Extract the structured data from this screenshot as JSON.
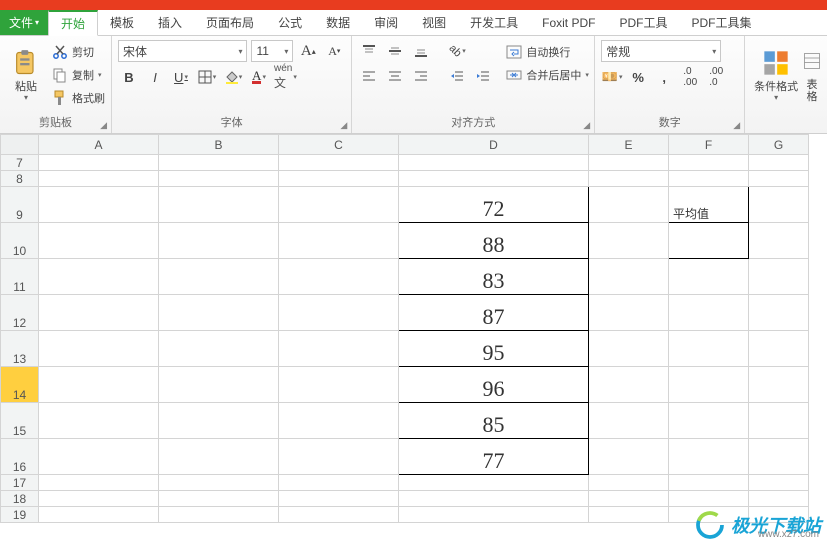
{
  "menu": {
    "file": "文件",
    "tabs": [
      "开始",
      "模板",
      "插入",
      "页面布局",
      "公式",
      "数据",
      "审阅",
      "视图",
      "开发工具",
      "Foxit PDF",
      "PDF工具",
      "PDF工具集"
    ],
    "active_index": 0
  },
  "ribbon": {
    "clipboard": {
      "label": "剪贴板",
      "paste": "粘贴",
      "cut": "剪切",
      "copy": "复制",
      "format_painter": "格式刷"
    },
    "font": {
      "label": "字体",
      "name": "宋体",
      "size": "11",
      "grow": "A",
      "shrink": "A",
      "bold": "B",
      "italic": "I",
      "underline": "U"
    },
    "align": {
      "label": "对齐方式",
      "wrap": "自动换行",
      "merge": "合并后居中"
    },
    "number": {
      "label": "数字",
      "format": "常规"
    },
    "styles": {
      "cond_format": "条件格式",
      "table_format": "表格"
    }
  },
  "sheet": {
    "cols": [
      "A",
      "B",
      "C",
      "D",
      "E",
      "F",
      "G"
    ],
    "rows": [
      7,
      8,
      9,
      10,
      11,
      12,
      13,
      14,
      15,
      16,
      17,
      18,
      19
    ],
    "selected_row": 14,
    "d_values": {
      "9": "72",
      "10": "88",
      "11": "83",
      "12": "87",
      "13": "95",
      "14": "96",
      "15": "85",
      "16": "77"
    },
    "f_label_row": 9,
    "f_label": "平均值"
  },
  "watermark": {
    "text": "极光下载站",
    "url": "www.xz7.com"
  }
}
